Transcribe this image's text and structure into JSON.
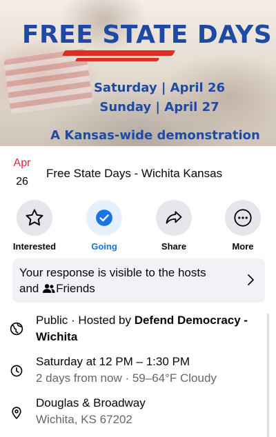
{
  "banner": {
    "title": "FREE STATE DAYS",
    "line1": "Saturday | April 26",
    "line2": "Sunday | April 27",
    "line3": "A Kansas-wide demonstration"
  },
  "event": {
    "month": "Apr",
    "day": "26",
    "title": "Free State Days - Wichita Kansas"
  },
  "actions": [
    {
      "label": "Interested",
      "icon": "star-icon",
      "active": false
    },
    {
      "label": "Going",
      "icon": "check-circle-icon",
      "active": true
    },
    {
      "label": "Share",
      "icon": "share-arrow-icon",
      "active": false
    },
    {
      "label": "More",
      "icon": "more-dots-icon",
      "active": false
    }
  ],
  "notice": {
    "text_before": "Your response is visible to the hosts and ",
    "friends_label": "Friends",
    "icon": "friends-icon"
  },
  "info": {
    "privacy": "Public",
    "hosted_prefix": " · Hosted by ",
    "host": "Defend Democracy - Wichita",
    "time": "Saturday at 12 PM – 1:30 PM",
    "time_sub": "2 days from now · 59–64°F Cloudy",
    "address": "Douglas & Broadway",
    "city": "Wichita, KS 67202"
  },
  "colors": {
    "accent": "#1b74e4",
    "date_month": "#e41e3f",
    "banner_text": "#1f4aa3",
    "banner_stripe": "#d93025",
    "secondary_text": "#65676b",
    "button_bg": "#e4e6eb",
    "notice_bg": "#f0f2f5"
  }
}
